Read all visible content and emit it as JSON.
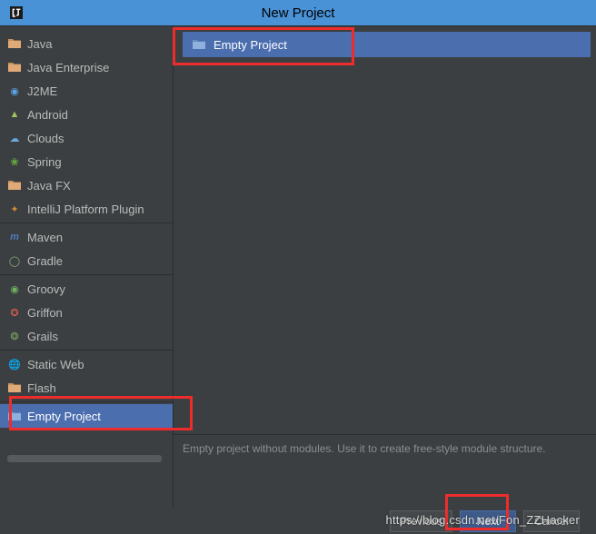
{
  "window": {
    "title": "New Project"
  },
  "sidebar": {
    "items": [
      {
        "label": "Java"
      },
      {
        "label": "Java Enterprise"
      },
      {
        "label": "J2ME"
      },
      {
        "label": "Android"
      },
      {
        "label": "Clouds"
      },
      {
        "label": "Spring"
      },
      {
        "label": "Java FX"
      },
      {
        "label": "IntelliJ Platform Plugin"
      },
      {
        "label": "Maven"
      },
      {
        "label": "Gradle"
      },
      {
        "label": "Groovy"
      },
      {
        "label": "Griffon"
      },
      {
        "label": "Grails"
      },
      {
        "label": "Static Web"
      },
      {
        "label": "Flash"
      },
      {
        "label": "Empty Project"
      }
    ]
  },
  "options": {
    "items": [
      {
        "label": "Empty Project"
      }
    ],
    "description": "Empty project without modules. Use it to create free-style module structure."
  },
  "footer": {
    "previous": "Previous",
    "next": "Next",
    "cancel": "Cancel"
  },
  "watermark": "https://blog.csdn.net/Fon_ZZHacker"
}
